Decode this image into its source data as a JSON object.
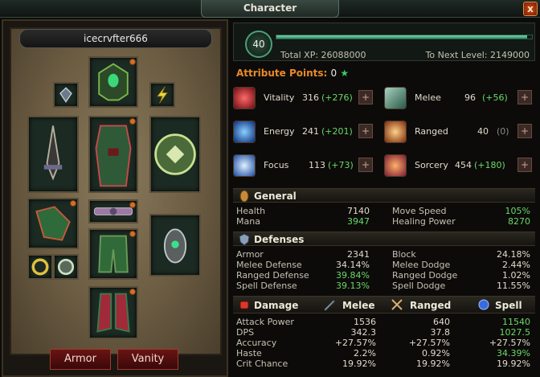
{
  "window": {
    "title": "Character",
    "close_label": "x"
  },
  "character": {
    "name": "icecrvfter666"
  },
  "tabs": {
    "armor_label": "Armor",
    "vanity_label": "Vanity"
  },
  "level": {
    "value": "40",
    "xp_progress": 0.98,
    "total_xp_label": "Total XP: 26088000",
    "next_level_label": "To Next Level: 2149000"
  },
  "attribute_points": {
    "label": "Attribute Points:",
    "value": "0",
    "star": "★"
  },
  "attributes": [
    {
      "name": "Vitality",
      "value": "316",
      "bonus": "(+276)",
      "plus": "+",
      "icon": "vitality-icon",
      "color": "#c0202a"
    },
    {
      "name": "Energy",
      "value": "241",
      "bonus": "(+201)",
      "plus": "+",
      "icon": "energy-icon",
      "color": "#2a6ad8"
    },
    {
      "name": "Focus",
      "value": "113",
      "bonus": "(+73)",
      "plus": "+",
      "icon": "focus-icon",
      "color": "#2a8ad8"
    },
    {
      "name": "Melee",
      "value": "96",
      "bonus": "(+56)",
      "plus": "+",
      "icon": "melee-icon",
      "color": "#5a8a78"
    },
    {
      "name": "Ranged",
      "value": "40",
      "bonus": "(0)",
      "plus": "+",
      "icon": "ranged-icon",
      "color": "#e0702a"
    },
    {
      "name": "Sorcery",
      "value": "454",
      "bonus": "(+180)",
      "plus": "+",
      "icon": "sorcery-icon",
      "color": "#d8502a"
    }
  ],
  "general": {
    "title": "General",
    "health_label": "Health",
    "health_value": "7140",
    "mana_label": "Mana",
    "mana_value": "3947",
    "move_speed_label": "Move Speed",
    "move_speed_value": "105%",
    "healing_power_label": "Healing Power",
    "healing_power_value": "8270"
  },
  "defenses": {
    "title": "Defenses",
    "rows": [
      {
        "l1": "Armor",
        "v1": "2341",
        "l2": "Block",
        "v2": "24.18%"
      },
      {
        "l1": "Melee Defense",
        "v1": "34.14%",
        "l2": "Melee Dodge",
        "v2": "2.44%"
      },
      {
        "l1": "Ranged Defense",
        "v1": "39.84%",
        "l2": "Ranged Dodge",
        "v2": "1.02%"
      },
      {
        "l1": "Spell Defense",
        "v1": "39.13%",
        "l2": "Spell Dodge",
        "v2": "11.55%"
      }
    ]
  },
  "damage": {
    "title": "Damage",
    "melee_label": "Melee",
    "ranged_label": "Ranged",
    "spell_label": "Spell",
    "rows": [
      {
        "label": "Attack Power",
        "melee": "1536",
        "ranged": "640",
        "spell": "11540"
      },
      {
        "label": "DPS",
        "melee": "342.3",
        "ranged": "37.8",
        "spell": "1027.5"
      },
      {
        "label": "Accuracy",
        "melee": "+27.57%",
        "ranged": "+27.57%",
        "spell": "+27.57%"
      },
      {
        "label": "Haste",
        "melee": "2.2%",
        "ranged": "0.92%",
        "spell": "34.39%"
      },
      {
        "label": "Crit Chance",
        "melee": "19.92%",
        "ranged": "19.92%",
        "spell": "19.92%"
      }
    ]
  }
}
